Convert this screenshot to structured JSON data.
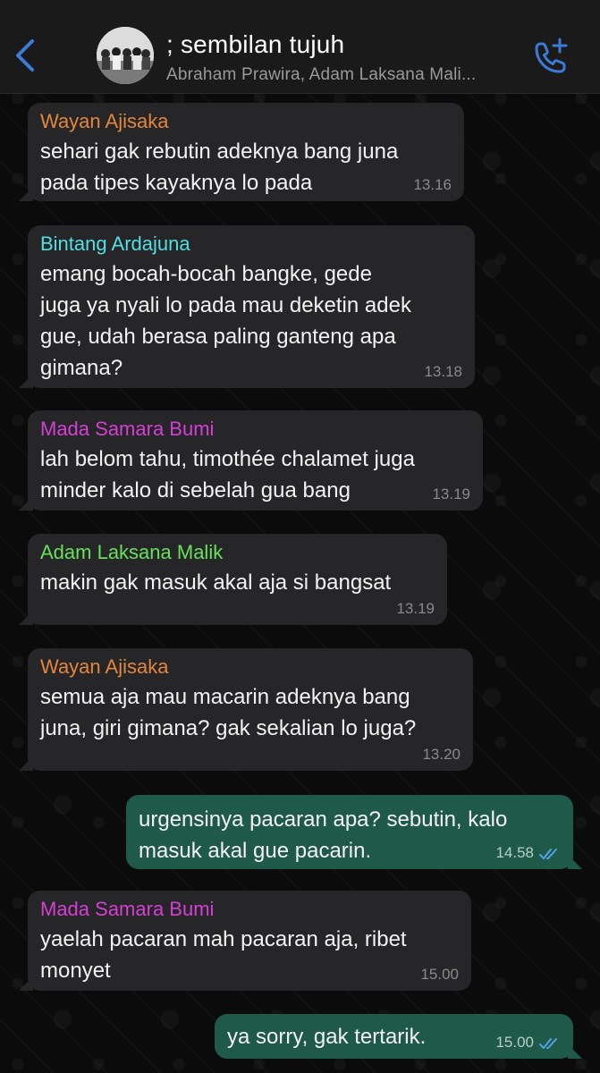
{
  "header": {
    "back_icon": "chevron-left-icon",
    "title": "; sembilan tujuh",
    "subtitle": "Abraham Prawira, Adam Laksana Mali...",
    "call_icon": "add-call-icon",
    "accent_color": "#3d7bd8"
  },
  "messages": [
    {
      "direction": "in",
      "sender": "Wayan Ajisaka",
      "sender_color": "#e3863d",
      "text": "sehari gak rebutin adeknya bang juna\npada tipes kayaknya lo pada",
      "time": "13.16"
    },
    {
      "direction": "in",
      "sender": "Bintang Ardajuna",
      "sender_color": "#54dde3",
      "text": "emang bocah-bocah bangke, gede\njuga ya nyali lo pada mau deketin adek\ngue, udah berasa paling ganteng apa\ngimana?",
      "time": "13.18"
    },
    {
      "direction": "in",
      "sender": "Mada Samara Bumi",
      "sender_color": "#d63fd6",
      "text": "lah belom tahu, timothée chalamet juga\nminder kalo di sebelah gua bang",
      "time": "13.19"
    },
    {
      "direction": "in",
      "sender": "Adam Laksana Malik",
      "sender_color": "#67e05c",
      "text": "makin gak masuk akal aja si bangsat",
      "time": "13.19"
    },
    {
      "direction": "in",
      "sender": "Wayan Ajisaka",
      "sender_color": "#e3863d",
      "text": "semua aja mau macarin adeknya bang\njuna, giri gimana? gak sekalian lo juga?",
      "time": "13.20"
    },
    {
      "direction": "out",
      "text": "urgensinya pacaran apa? sebutin, kalo\nmasuk akal gue pacarin.",
      "time": "14.58",
      "status_icon": "double-check-read-icon"
    },
    {
      "direction": "in",
      "sender": "Mada Samara Bumi",
      "sender_color": "#d63fd6",
      "text": "yaelah pacaran mah pacaran aja, ribet\nmonyet",
      "time": "15.00"
    },
    {
      "direction": "out",
      "text": "ya sorry, gak tertarik.",
      "time": "15.00",
      "status_icon": "double-check-read-icon"
    }
  ]
}
